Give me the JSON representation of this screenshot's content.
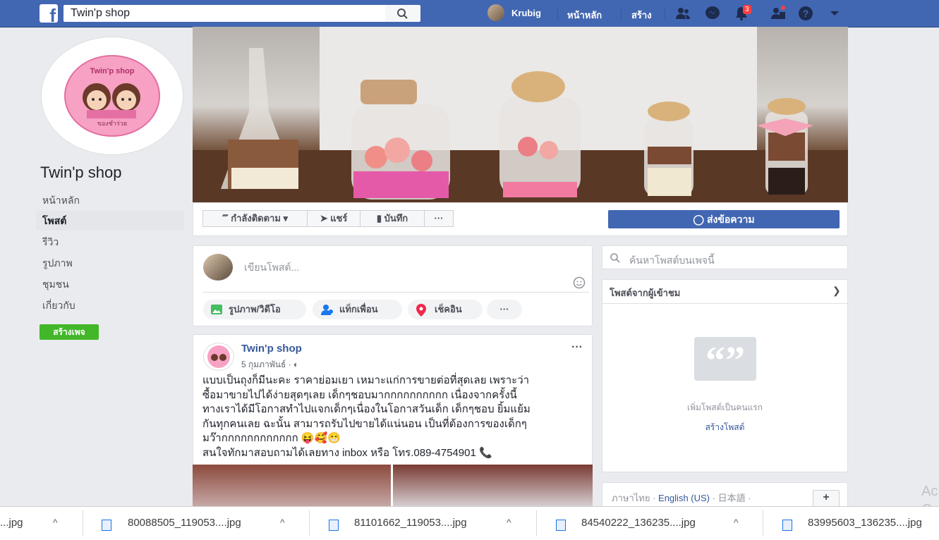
{
  "topbar": {
    "search_value": "Twin'p shop",
    "user_name": "Krubig",
    "home_label": "หน้าหลัก",
    "create_label": "สร้าง",
    "notification_count": "3"
  },
  "sidebar": {
    "page_name": "Twin'p shop",
    "logo_text": "Twin'p shop",
    "logo_subtext": "ของชำร่วย",
    "items": [
      {
        "label": "หน้าหลัก"
      },
      {
        "label": "โพสต์"
      },
      {
        "label": "รีวิว"
      },
      {
        "label": "รูปภาพ"
      },
      {
        "label": "ชุมชน"
      },
      {
        "label": "เกี่ยวกับ"
      }
    ],
    "create_page_label": "สร้างเพจ"
  },
  "action_bar": {
    "following_label": "กำลังติดตาม",
    "share_label": "แชร์",
    "save_label": "บันทึก",
    "more_label": "···",
    "message_label": "ส่งข้อความ"
  },
  "composer": {
    "placeholder": "เขียนโพสต์...",
    "photo_label": "รูปภาพ/วิดีโอ",
    "tag_label": "แท็กเพื่อน",
    "checkin_label": "เช็คอิน",
    "more_label": "···"
  },
  "post": {
    "author": "Twin'p shop",
    "date": "5 กุมภาพันธ์ ·",
    "more_label": "···",
    "text": "แบบเป็นถุงก็มีนะคะ ราคาย่อมเยา เหมาะแก่การขายต่อที่สุดเลย เพราะว่า\nซื้อมาขายไปได้ง่ายสุดๆเลย เด็กๆชอบมากกกกกกกกกก เนื่องจากครั้งนี้\nทางเราได้มีโอกาสทำไปแจกเด็กๆเนื่องในโอกาสวันเด็ก เด็กๆชอบ ยิ้มแย้ม\nกันทุกคนเลย ฉะนั้น สามารถรับไปขายได้แน่นอน เป็นที่ต้องการของเด็กๆ\nมว๊ากกกกกกกกกกกก 😝🥰😁\nสนใจทักมาสอบถามได้เลยทาง inbox หรือ โทร.089-4754901 📞"
  },
  "right": {
    "search_placeholder": "ค้นหาโพสต์บนเพจนี้",
    "visitor_posts_title": "โพสต์จากผู้เข้าชม",
    "first_post_text": "เพิ่มโพสต์เป็นคนแรก",
    "create_post_link": "สร้างโพสต์",
    "lang_thai": "ภาษาไทย ·",
    "lang_english": "English (US)",
    "lang_japanese": "· 日本語 ·",
    "lang_add": "+",
    "watermark": "Ac\nGo"
  },
  "downloads": {
    "items": [
      {
        "name": "...jpg"
      },
      {
        "name": "80088505_119053....jpg"
      },
      {
        "name": "81101662_119053....jpg"
      },
      {
        "name": "84540222_136235....jpg"
      },
      {
        "name": "83995603_136235....jpg"
      }
    ]
  },
  "colors": {
    "fb_blue": "#4267b2",
    "link_blue": "#365899",
    "create_green": "#42b72a",
    "badge_red": "#fa3e3e"
  }
}
